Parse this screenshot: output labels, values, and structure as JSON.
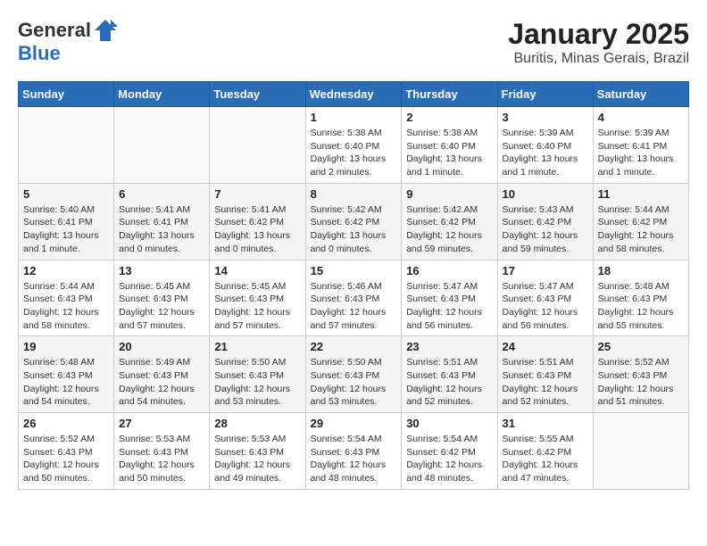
{
  "header": {
    "logo_line1": "General",
    "logo_line2": "Blue",
    "title": "January 2025",
    "subtitle": "Buritis, Minas Gerais, Brazil"
  },
  "columns": [
    "Sunday",
    "Monday",
    "Tuesday",
    "Wednesday",
    "Thursday",
    "Friday",
    "Saturday"
  ],
  "weeks": [
    [
      {
        "num": "",
        "info": ""
      },
      {
        "num": "",
        "info": ""
      },
      {
        "num": "",
        "info": ""
      },
      {
        "num": "1",
        "info": "Sunrise: 5:38 AM\nSunset: 6:40 PM\nDaylight: 13 hours and 2 minutes."
      },
      {
        "num": "2",
        "info": "Sunrise: 5:38 AM\nSunset: 6:40 PM\nDaylight: 13 hours and 1 minute."
      },
      {
        "num": "3",
        "info": "Sunrise: 5:39 AM\nSunset: 6:40 PM\nDaylight: 13 hours and 1 minute."
      },
      {
        "num": "4",
        "info": "Sunrise: 5:39 AM\nSunset: 6:41 PM\nDaylight: 13 hours and 1 minute."
      }
    ],
    [
      {
        "num": "5",
        "info": "Sunrise: 5:40 AM\nSunset: 6:41 PM\nDaylight: 13 hours and 1 minute."
      },
      {
        "num": "6",
        "info": "Sunrise: 5:41 AM\nSunset: 6:41 PM\nDaylight: 13 hours and 0 minutes."
      },
      {
        "num": "7",
        "info": "Sunrise: 5:41 AM\nSunset: 6:42 PM\nDaylight: 13 hours and 0 minutes."
      },
      {
        "num": "8",
        "info": "Sunrise: 5:42 AM\nSunset: 6:42 PM\nDaylight: 13 hours and 0 minutes."
      },
      {
        "num": "9",
        "info": "Sunrise: 5:42 AM\nSunset: 6:42 PM\nDaylight: 12 hours and 59 minutes."
      },
      {
        "num": "10",
        "info": "Sunrise: 5:43 AM\nSunset: 6:42 PM\nDaylight: 12 hours and 59 minutes."
      },
      {
        "num": "11",
        "info": "Sunrise: 5:44 AM\nSunset: 6:42 PM\nDaylight: 12 hours and 58 minutes."
      }
    ],
    [
      {
        "num": "12",
        "info": "Sunrise: 5:44 AM\nSunset: 6:43 PM\nDaylight: 12 hours and 58 minutes."
      },
      {
        "num": "13",
        "info": "Sunrise: 5:45 AM\nSunset: 6:43 PM\nDaylight: 12 hours and 57 minutes."
      },
      {
        "num": "14",
        "info": "Sunrise: 5:45 AM\nSunset: 6:43 PM\nDaylight: 12 hours and 57 minutes."
      },
      {
        "num": "15",
        "info": "Sunrise: 5:46 AM\nSunset: 6:43 PM\nDaylight: 12 hours and 57 minutes."
      },
      {
        "num": "16",
        "info": "Sunrise: 5:47 AM\nSunset: 6:43 PM\nDaylight: 12 hours and 56 minutes."
      },
      {
        "num": "17",
        "info": "Sunrise: 5:47 AM\nSunset: 6:43 PM\nDaylight: 12 hours and 56 minutes."
      },
      {
        "num": "18",
        "info": "Sunrise: 5:48 AM\nSunset: 6:43 PM\nDaylight: 12 hours and 55 minutes."
      }
    ],
    [
      {
        "num": "19",
        "info": "Sunrise: 5:48 AM\nSunset: 6:43 PM\nDaylight: 12 hours and 54 minutes."
      },
      {
        "num": "20",
        "info": "Sunrise: 5:49 AM\nSunset: 6:43 PM\nDaylight: 12 hours and 54 minutes."
      },
      {
        "num": "21",
        "info": "Sunrise: 5:50 AM\nSunset: 6:43 PM\nDaylight: 12 hours and 53 minutes."
      },
      {
        "num": "22",
        "info": "Sunrise: 5:50 AM\nSunset: 6:43 PM\nDaylight: 12 hours and 53 minutes."
      },
      {
        "num": "23",
        "info": "Sunrise: 5:51 AM\nSunset: 6:43 PM\nDaylight: 12 hours and 52 minutes."
      },
      {
        "num": "24",
        "info": "Sunrise: 5:51 AM\nSunset: 6:43 PM\nDaylight: 12 hours and 52 minutes."
      },
      {
        "num": "25",
        "info": "Sunrise: 5:52 AM\nSunset: 6:43 PM\nDaylight: 12 hours and 51 minutes."
      }
    ],
    [
      {
        "num": "26",
        "info": "Sunrise: 5:52 AM\nSunset: 6:43 PM\nDaylight: 12 hours and 50 minutes."
      },
      {
        "num": "27",
        "info": "Sunrise: 5:53 AM\nSunset: 6:43 PM\nDaylight: 12 hours and 50 minutes."
      },
      {
        "num": "28",
        "info": "Sunrise: 5:53 AM\nSunset: 6:43 PM\nDaylight: 12 hours and 49 minutes."
      },
      {
        "num": "29",
        "info": "Sunrise: 5:54 AM\nSunset: 6:43 PM\nDaylight: 12 hours and 48 minutes."
      },
      {
        "num": "30",
        "info": "Sunrise: 5:54 AM\nSunset: 6:42 PM\nDaylight: 12 hours and 48 minutes."
      },
      {
        "num": "31",
        "info": "Sunrise: 5:55 AM\nSunset: 6:42 PM\nDaylight: 12 hours and 47 minutes."
      },
      {
        "num": "",
        "info": ""
      }
    ]
  ]
}
